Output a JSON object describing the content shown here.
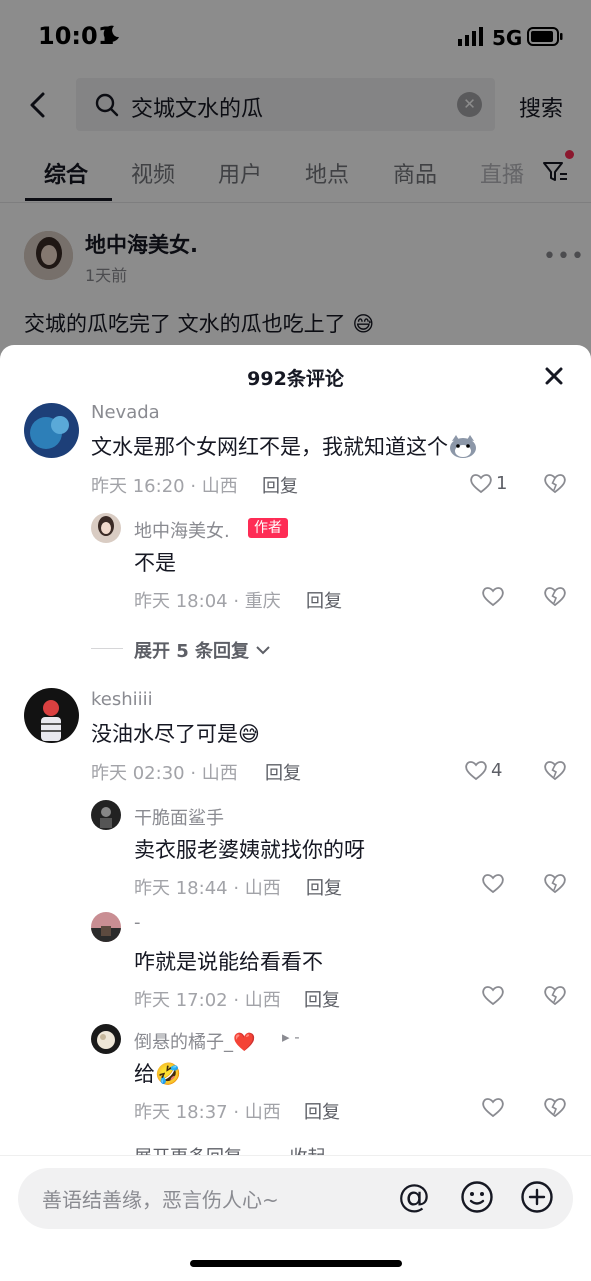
{
  "status_bar": {
    "time": "10:01",
    "network": "5G"
  },
  "search": {
    "query": "交城文水的瓜",
    "button": "搜索"
  },
  "tabs": [
    "综合",
    "视频",
    "用户",
    "地点",
    "商品",
    "直播"
  ],
  "post": {
    "author": "地中海美女.",
    "time": "1天前",
    "text": "交城的瓜吃完了 文水的瓜也吃上了 😅"
  },
  "comments_panel": {
    "title": "992条评论",
    "comments": [
      {
        "name": "Nevada",
        "text": "文水是那个女网红不是，我就知道这个",
        "time": "昨天 16:20 · 山西",
        "reply_label": "回复",
        "likes": "1",
        "replies": [
          {
            "name": "地中海美女.",
            "badge": "作者",
            "text": "不是",
            "time": "昨天 18:04 · 重庆",
            "reply_label": "回复"
          }
        ],
        "expand": "展开 5 条回复"
      },
      {
        "name": "keshiiii",
        "text": "没油水尽了可是😅",
        "time": "昨天 02:30 · 山西",
        "reply_label": "回复",
        "likes": "4",
        "replies": [
          {
            "name": "干脆面鲨手",
            "text": "卖衣服老婆姨就找你的呀",
            "time": "昨天 18:44 · 山西",
            "reply_label": "回复"
          },
          {
            "name": "-",
            "text": "咋就是说能给看看不",
            "time": "昨天 17:02 · 山西",
            "reply_label": "回复"
          },
          {
            "name": "倒悬的橘子_❤️",
            "target": "▸ -",
            "text": "给🤣",
            "time": "昨天 18:37 · 山西",
            "reply_label": "回复"
          }
        ]
      }
    ],
    "peek_text": "展开更多回复 —— 收起"
  },
  "input": {
    "placeholder": "善语结善缘，恶言伤人心~",
    "at": "@"
  },
  "colors": {
    "accent": "#fe2c55",
    "text": "#161823",
    "muted": "#8a8b91"
  }
}
